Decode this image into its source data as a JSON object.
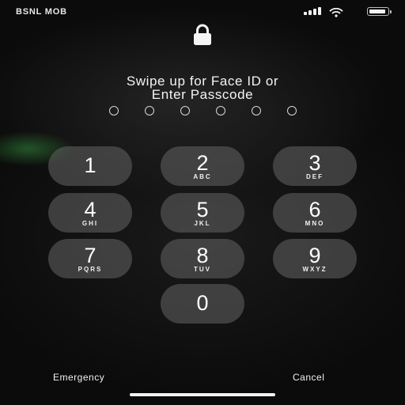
{
  "status_bar": {
    "carrier": "BSNL MOB",
    "signal_bars_filled": 4,
    "battery_level": 0.9
  },
  "icons": {
    "lock": "lock-icon",
    "signal": "signal-icon",
    "wifi": "wifi-icon",
    "battery": "battery-icon"
  },
  "prompt": {
    "line1": "Swipe up for Face ID or",
    "line2": "Enter Passcode"
  },
  "passcode": {
    "length": 6,
    "entered": 0
  },
  "keypad": [
    {
      "digit": "1",
      "letters": ""
    },
    {
      "digit": "2",
      "letters": "ABC"
    },
    {
      "digit": "3",
      "letters": "DEF"
    },
    {
      "digit": "4",
      "letters": "GHI"
    },
    {
      "digit": "5",
      "letters": "JKL"
    },
    {
      "digit": "6",
      "letters": "MNO"
    },
    {
      "digit": "7",
      "letters": "PQRS"
    },
    {
      "digit": "8",
      "letters": "TUV"
    },
    {
      "digit": "9",
      "letters": "WXYZ"
    },
    {
      "digit": "0",
      "letters": ""
    }
  ],
  "actions": {
    "emergency": "Emergency",
    "cancel": "Cancel"
  },
  "colors": {
    "background": "#0d0d0d",
    "key_fill": "#646464",
    "text": "#ffffff"
  }
}
